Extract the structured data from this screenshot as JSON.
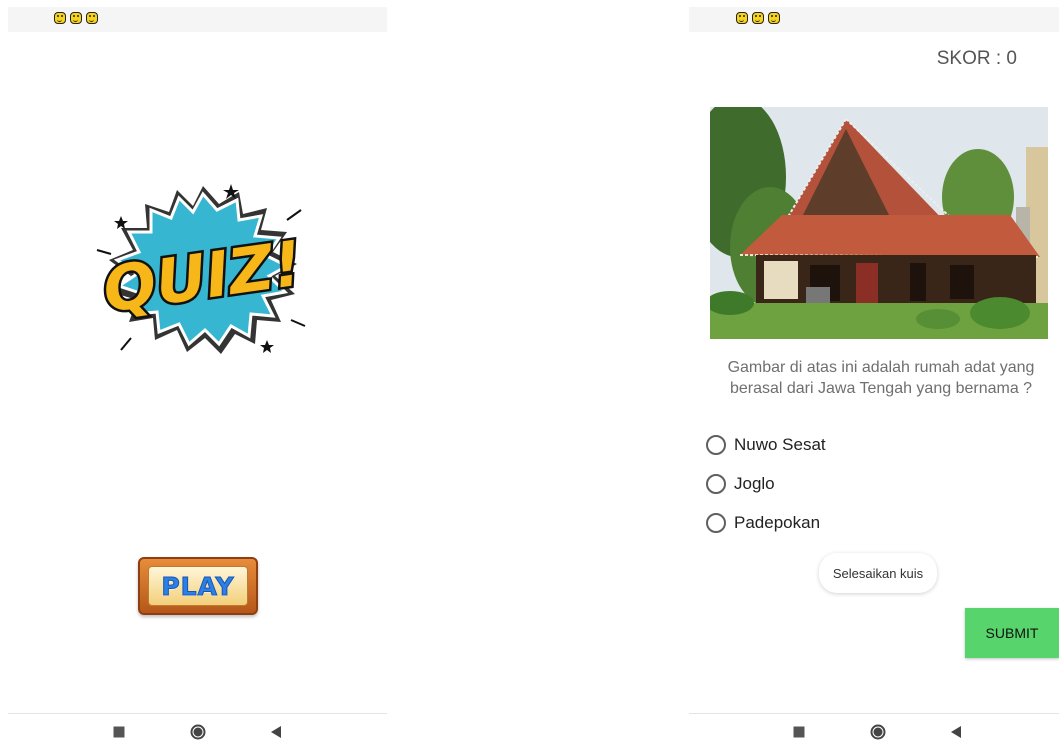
{
  "start_screen": {
    "status_bar": {
      "icons": [
        "smiley-icon",
        "smiley-icon",
        "smiley-icon"
      ]
    },
    "logo": {
      "text": "QUIZ!",
      "icon": "quiz-burst-logo"
    },
    "play_button": {
      "label": "PLAY"
    },
    "nav_bar": {
      "icons": [
        "recents-square-icon",
        "home-circle-icon",
        "back-triangle-icon"
      ]
    }
  },
  "quiz_screen": {
    "status_bar": {
      "icons": [
        "smiley-icon",
        "smiley-icon",
        "smiley-icon"
      ]
    },
    "score": {
      "label": "SKOR : 0"
    },
    "question": {
      "image": "traditional-house-photo",
      "text": "Gambar di atas ini adalah rumah adat yang berasal dari Jawa Tengah yang bernama ?"
    },
    "options": [
      {
        "label": "Nuwo Sesat",
        "selected": false
      },
      {
        "label": "Joglo",
        "selected": false
      },
      {
        "label": "Padepokan",
        "selected": false
      }
    ],
    "toast": {
      "text": "Selesaikan kuis"
    },
    "submit_button": {
      "label": "SUBMIT"
    },
    "nav_bar": {
      "icons": [
        "recents-square-icon",
        "home-circle-icon",
        "back-triangle-icon"
      ]
    }
  },
  "colors": {
    "submit_green": "#58d46c",
    "play_blue": "#2c7fe6",
    "play_wood": "#d9782e",
    "logo_yellow": "#f7b719",
    "logo_cyan": "#37b6d2"
  }
}
